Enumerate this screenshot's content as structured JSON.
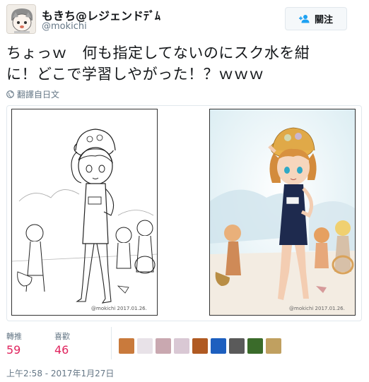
{
  "header": {
    "display_name": "もきち@レジェンドﾃﾞﾑ",
    "screen_name": "@mokichi",
    "follow_label": "關注"
  },
  "tweet": {
    "text_line1": "ちょっｗ　何も指定してないのにスク水を紺",
    "text_line2": "に！どこで学習しやがった！？ｗｗｗ",
    "translate_label": "翻譯自日文"
  },
  "media": {
    "left_signature": "@mokichi  2017.01.26.",
    "right_signature": "@mokichi  2017.01.26."
  },
  "stats": {
    "retweets_label": "轉推",
    "retweets_value": "59",
    "likes_label": "喜歡",
    "likes_value": "46"
  },
  "likers": {
    "colors": [
      "#c97a3c",
      "#e8e2e8",
      "#c9a8b0",
      "#d9c8d4",
      "#b05a22",
      "#1d5fbf",
      "#5a5a5a",
      "#3a6b2a",
      "#c0a060"
    ]
  },
  "timestamp": "上午2:58 - 2017年1月27日"
}
